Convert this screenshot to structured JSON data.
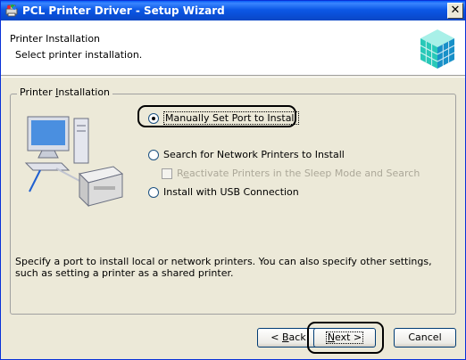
{
  "window": {
    "title": "PCL Printer Driver - Setup Wizard",
    "close_glyph": "✕",
    "icon": "printer-app-icon"
  },
  "header": {
    "title": "Printer Installation",
    "subtitle": "Select printer installation.",
    "logo_icon": "printer-cube-logo-icon"
  },
  "group": {
    "label_before": "Printer ",
    "label_accel": "I",
    "label_after": "nstallation"
  },
  "options": {
    "manual": {
      "label": "Manually Set Port to Install",
      "checked": true
    },
    "network": {
      "label": "Search for Network Printers to Install",
      "checked": false
    },
    "reactivate": {
      "label_before": "R",
      "label_accel": "e",
      "label_after": "activate Printers in the Sleep Mode and Search",
      "checked": false,
      "disabled": true
    },
    "usb": {
      "label": "Install with USB Connection",
      "checked": false
    }
  },
  "description": "Specify a port to install local or network printers. You can also specify other settings, such as setting a printer as a shared printer.",
  "buttons": {
    "back": {
      "prefix": "< ",
      "accel": "B",
      "rest": "ack"
    },
    "next": {
      "accel": "N",
      "rest": "ext >"
    },
    "cancel": "Cancel"
  },
  "colors": {
    "titlebar": "#0a5ef7",
    "dialog_bg": "#ece9d8",
    "disabled_text": "#aca899"
  }
}
